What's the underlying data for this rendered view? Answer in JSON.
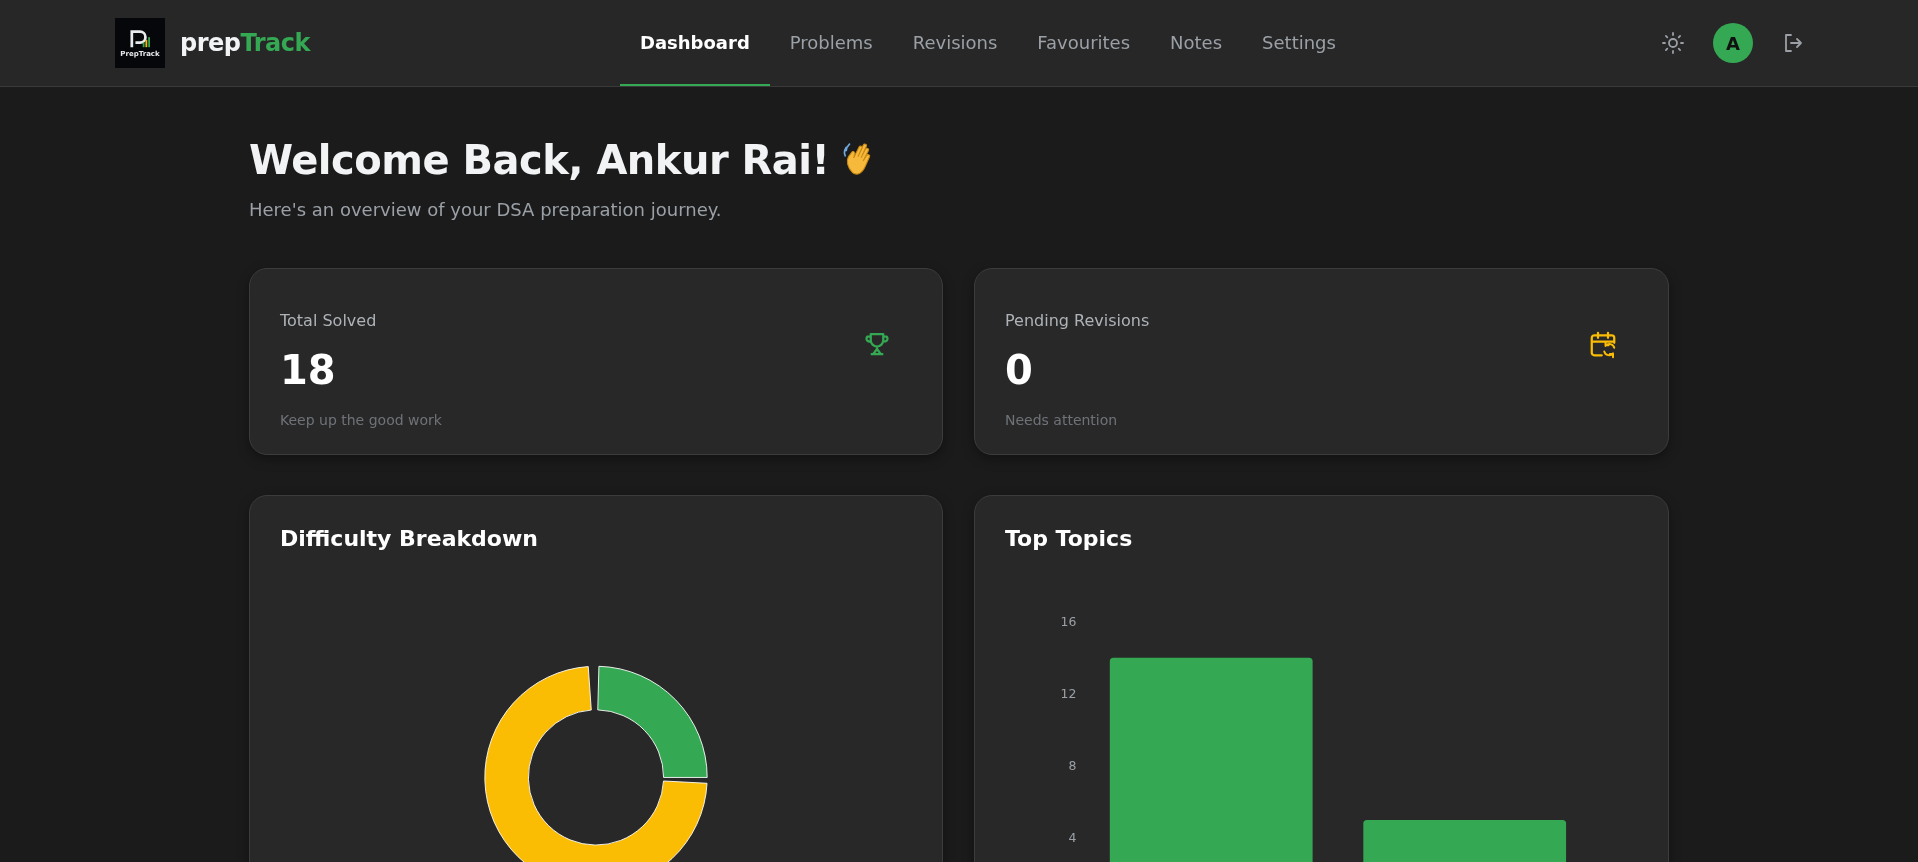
{
  "brand": {
    "logo_text": "PrepTrack",
    "name_first": "prep",
    "name_second": "Track"
  },
  "nav": [
    {
      "label": "Dashboard",
      "selected": true
    },
    {
      "label": "Problems",
      "selected": false
    },
    {
      "label": "Revisions",
      "selected": false
    },
    {
      "label": "Favourites",
      "selected": false
    },
    {
      "label": "Notes",
      "selected": false
    },
    {
      "label": "Settings",
      "selected": false
    }
  ],
  "avatar": {
    "initial": "A"
  },
  "welcome": {
    "title": "Welcome Back, Ankur Rai!",
    "subtitle": "Here's an overview of your DSA preparation journey."
  },
  "stats": [
    {
      "kind": "trophy",
      "label": "Total Solved",
      "value": "18",
      "note": "Keep up the good work"
    },
    {
      "kind": "calendar",
      "label": "Pending Revisions",
      "value": "0",
      "note": "Needs attention"
    }
  ],
  "difficulty": {
    "title": "Difficulty Breakdown"
  },
  "topics": {
    "title": "Top Topics",
    "chart_data": {
      "type": "bar",
      "ylim": [
        0,
        16
      ],
      "yticks": [
        4,
        8,
        12,
        16
      ],
      "series": [
        {
          "color": "#34a853",
          "values": [
            14,
            5
          ]
        }
      ]
    }
  }
}
